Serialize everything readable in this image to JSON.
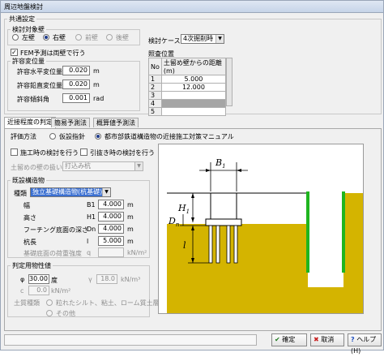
{
  "title": "周辺地盤検討",
  "common": {
    "group_label": "共通設定",
    "target_group_label": "検討対象壁",
    "target_options": [
      {
        "label": "左壁",
        "selected": false,
        "enabled": true
      },
      {
        "label": "右壁",
        "selected": true,
        "enabled": true
      },
      {
        "label": "前壁",
        "selected": false,
        "enabled": false
      },
      {
        "label": "後壁",
        "selected": false,
        "enabled": false
      }
    ],
    "fem_check_label": "FEM予測は両壁で行う",
    "fem_checked": true,
    "allow_group_label": "許容変位量",
    "allow_rows": [
      {
        "label": "許容水平変位量",
        "value": "0.020",
        "unit": "m"
      },
      {
        "label": "許容鉛直変位量",
        "value": "0.020",
        "unit": "m"
      },
      {
        "label": "許容傾斜角",
        "value": "0.001",
        "unit": "rad"
      }
    ]
  },
  "case": {
    "label": "検討ケース",
    "value": "4次掘削時",
    "section_label": "照査位置",
    "col_no": "No",
    "col_dist": "土留め壁からの距離(m)",
    "rows": [
      {
        "no": "1",
        "value": "5.000"
      },
      {
        "no": "2",
        "value": "12.000"
      },
      {
        "no": "3",
        "value": ""
      },
      {
        "no": "4",
        "value": ""
      },
      {
        "no": "5",
        "value": ""
      }
    ]
  },
  "tabs": [
    "近接程度の判定",
    "簡易予測法",
    "概算値予測法"
  ],
  "method": {
    "label": "評価方法",
    "options": [
      {
        "label": "仮設指針",
        "selected": false
      },
      {
        "label": "都市部鉄道構造物の近接施工対策マニュアル",
        "selected": true
      }
    ]
  },
  "checks": {
    "install_label": "施工時の検討を行う",
    "install_checked": false,
    "pull_label": "引抜き時の検討を行う",
    "pull_checked": false
  },
  "wall_handling": {
    "label": "土留めの壁の扱い",
    "value": "打込み杭"
  },
  "structure": {
    "group_label": "既設構造物",
    "type_label": "種類",
    "type_value": "独立基礎構造物(杭基礎)",
    "rows": [
      {
        "label": "幅",
        "sym": "B1",
        "value": "4.000",
        "unit": "m",
        "enabled": true
      },
      {
        "label": "高さ",
        "sym": "H1",
        "value": "4.000",
        "unit": "m",
        "enabled": true
      },
      {
        "label": "フーチング底面の深さ",
        "sym": "Dn",
        "value": "4.000",
        "unit": "m",
        "enabled": true
      },
      {
        "label": "杭長",
        "sym": "l",
        "value": "5.000",
        "unit": "m",
        "enabled": true
      },
      {
        "label": "基礎底面の荷重強度",
        "sym": "q",
        "value": "",
        "unit": "kN/m²",
        "enabled": false
      }
    ]
  },
  "soil": {
    "group_label": "判定用物性値",
    "phi_sym": "φ",
    "phi_value": "30.00",
    "phi_unit": "度",
    "gamma_sym": "γ",
    "gamma_value": "18.0",
    "gamma_unit": "kN/m³",
    "c_sym": "c",
    "c_value": "0.0",
    "c_unit": "kN/m²",
    "soil_type_label": "土質種類",
    "soil_options": [
      {
        "label": "粒れたシルト、粘土、ローム質土層",
        "selected": true
      },
      {
        "label": "その他",
        "selected": false
      }
    ]
  },
  "diagram": {
    "label_b1": "B",
    "label_b1_sub": "1",
    "label_h1": "H",
    "label_h1_sub": "1",
    "label_dn": "D",
    "label_dn_sub": "n",
    "label_l": "l",
    "soil_color": "#d4b400",
    "wall_color": "#1fb51f"
  },
  "buttons": {
    "ok": "確定",
    "cancel": "取消",
    "help": "ヘルプ(H)"
  }
}
